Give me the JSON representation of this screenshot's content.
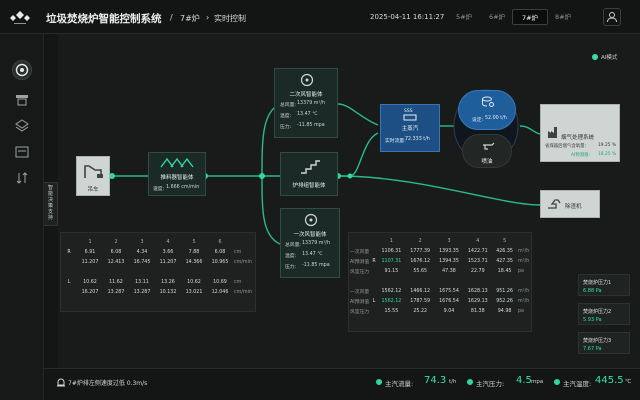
{
  "header": {
    "title": "垃圾焚烧炉智能控制系统",
    "breadcrumb": [
      "7#炉",
      "实时控制"
    ],
    "datetime": "2025-04-11 16:11:27",
    "furnace_tabs": [
      "5#炉",
      "6#炉",
      "7#炉",
      "8#炉"
    ],
    "active_tab": "7#炉"
  },
  "sidebar": {
    "items": [
      "dashboard-icon",
      "monitor-icon",
      "layers-icon",
      "archive-icon",
      "sort-icon"
    ],
    "side_tab": [
      "智",
      "能",
      "决",
      "策",
      "支",
      "持"
    ]
  },
  "ai_mode": "AI模式",
  "nodes": {
    "crane": "吊车",
    "pusher": {
      "title": "推料器智能体",
      "speed_label": "速度:",
      "speed": "1.666 cm/min"
    },
    "secondary_air": {
      "title": "二次风智能体",
      "rows": [
        {
          "label": "总风量:",
          "value": "13379 m³/h"
        },
        {
          "label": "温度:",
          "value": "13.47 ℃"
        },
        {
          "label": "压力:",
          "value": "-11.85 mpa"
        }
      ]
    },
    "grate": {
      "title": "炉排组智能体"
    },
    "primary_air": {
      "title": "一次风智能体",
      "rows": [
        {
          "label": "总风量:",
          "value": "13379 m³/h"
        },
        {
          "label": "温度:",
          "value": "13.47 ℃"
        },
        {
          "label": "压力:",
          "value": "-11.85 mpa"
        }
      ]
    },
    "main_steam": {
      "badge": "SSS",
      "title": "主蒸汽",
      "flow_label": "实时流量:",
      "flow": "72.333 t/h"
    },
    "setpoint": {
      "label": "设定:",
      "value": "52.00 t/h"
    },
    "spray": {
      "label": "喷油"
    },
    "flue_gas": {
      "title": "烟气处理系统",
      "line1_label": "省煤器后烟气含氧量:",
      "line1_value": "19.25 %",
      "line2_label": "AI预测值:",
      "line2_value": "18.25 %"
    },
    "slag": "除渣机"
  },
  "left_table": {
    "headers": [
      "1",
      "2",
      "3",
      "4",
      "5",
      "6"
    ],
    "rows": [
      {
        "side": "R",
        "values": [
          "6.91",
          "6.08",
          "4.34",
          "3.66",
          "7.88",
          "6.08"
        ],
        "unit": "cm"
      },
      {
        "side": "",
        "values": [
          "11.207",
          "12.413",
          "16.745",
          "11.207",
          "14.366",
          "10.965"
        ],
        "unit": "cm/min"
      },
      {
        "side": "L",
        "values": [
          "10.62",
          "11.62",
          "13.11",
          "13.26",
          "10.62",
          "10.69"
        ],
        "unit": "cm"
      },
      {
        "side": "",
        "values": [
          "16.207",
          "13.287",
          "13.287",
          "10.132",
          "13.021",
          "12.046"
        ],
        "unit": "cm/min"
      }
    ]
  },
  "right_table": {
    "headers": [
      "1",
      "2",
      "3",
      "4",
      "5"
    ],
    "groups": [
      {
        "side": "R",
        "rows": [
          {
            "label": "一次风量",
            "values": [
              "1106.31",
              "1777.39",
              "1393.35",
              "1422.71",
              "426.35"
            ],
            "unit": "m³/h",
            "ai": false
          },
          {
            "label": "AI预测值",
            "values": [
              "1107.31",
              "1676.12",
              "1394.35",
              "1523.71",
              "427.35"
            ],
            "unit": "m³/h",
            "ai": true
          },
          {
            "label": "风室压力",
            "values": [
              "91.15",
              "55.65",
              "47.38",
              "22.79",
              "18.45"
            ],
            "unit": "pa",
            "ai": false
          }
        ]
      },
      {
        "side": "L",
        "rows": [
          {
            "label": "一次风量",
            "values": [
              "1562.12",
              "1466.12",
              "1675.54",
              "1628.13",
              "951.26"
            ],
            "unit": "m³/h",
            "ai": false
          },
          {
            "label": "AI预测值",
            "values": [
              "1562.12",
              "1787.59",
              "1676.54",
              "1629.13",
              "952.26"
            ],
            "unit": "m³/h",
            "ai": true
          },
          {
            "label": "风室压力",
            "values": [
              "15.55",
              "25.22",
              "9.04",
              "81.38",
              "94.98"
            ],
            "unit": "pa",
            "ai": false
          }
        ]
      }
    ]
  },
  "cards": [
    {
      "title": "焚烧炉压力1",
      "value": "6.88 Pa"
    },
    {
      "title": "焚烧炉压力2",
      "value": "5.93 Pa"
    },
    {
      "title": "焚烧炉压力3",
      "value": "7.67 Pa"
    }
  ],
  "footer": {
    "alert": "7#炉排左侧速度过低 0.3m/s",
    "steam_flow_label": "主汽流量:",
    "steam_flow": "74.3",
    "steam_flow_unit": "t/h",
    "steam_pressure_label": "主汽压力:",
    "steam_pressure": "4.5",
    "steam_pressure_unit": "mpa",
    "steam_temp_label": "主汽温度:",
    "steam_temp": "445.5",
    "steam_temp_unit": "℃"
  },
  "colors": {
    "accent": "#37e0a9",
    "line": "#2bb98d",
    "steam": "#1e5e9a",
    "background": "#141615"
  }
}
